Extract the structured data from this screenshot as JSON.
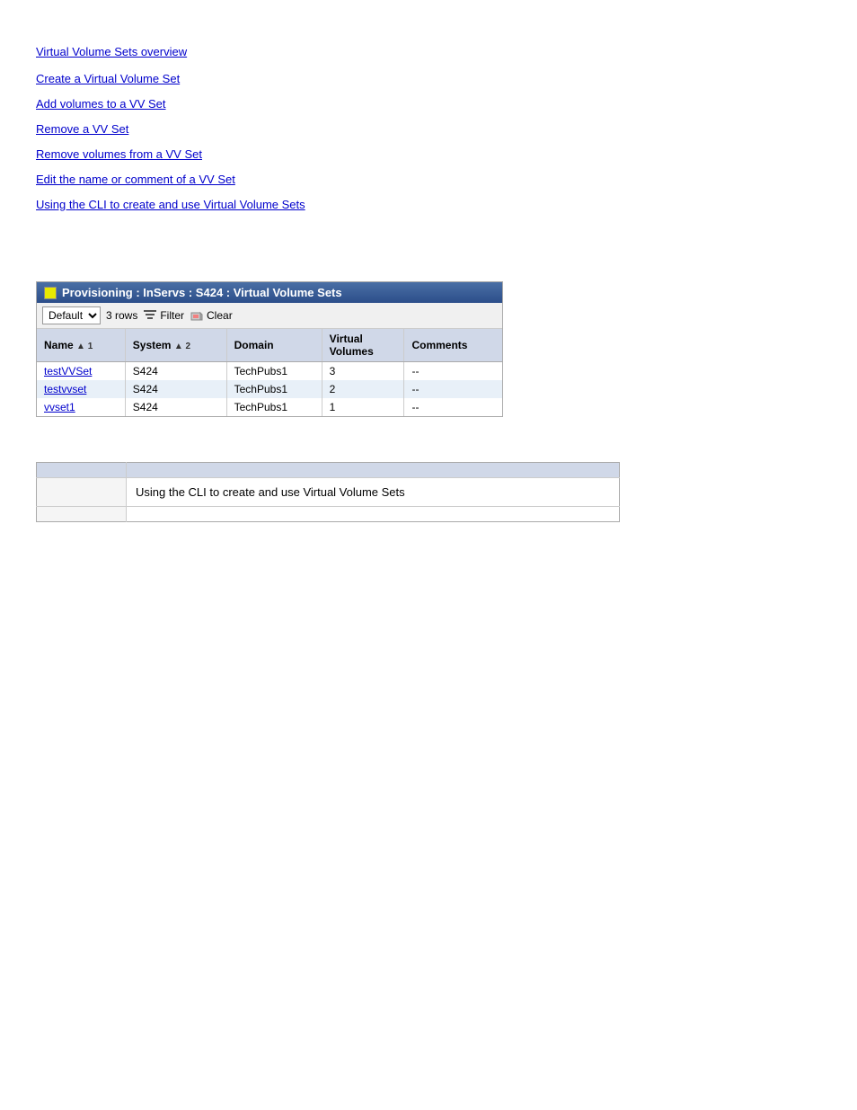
{
  "top_link": {
    "label": "Virtual Volume Sets overview"
  },
  "links_section": {
    "items": [
      {
        "label": "Create a Virtual Volume Set"
      },
      {
        "label": "Add volumes to a VV Set"
      },
      {
        "label": "Remove a VV Set"
      },
      {
        "label": "Remove volumes from a VV Set"
      },
      {
        "label": "Edit the name or comment of a VV Set"
      },
      {
        "label": "Using the CLI to create and use Virtual Volume Sets"
      }
    ]
  },
  "panel": {
    "title": "Provisioning : InServs : S424 : Virtual Volume Sets",
    "toolbar": {
      "view_label": "Default",
      "rows_count": "3 rows",
      "filter_label": "Filter",
      "clear_label": "Clear"
    },
    "columns": [
      {
        "label": "Name",
        "sort": "▲ 1"
      },
      {
        "label": "System",
        "sort": "▲ 2"
      },
      {
        "label": "Domain",
        "sort": ""
      },
      {
        "label": "Virtual\nVolumes",
        "sort": ""
      },
      {
        "label": "Comments",
        "sort": ""
      }
    ],
    "rows": [
      {
        "name": "testVVSet",
        "system": "S424",
        "domain": "TechPubs1",
        "volumes": "3",
        "comments": "--"
      },
      {
        "name": "testvvset",
        "system": "S424",
        "domain": "TechPubs1",
        "volumes": "2",
        "comments": "--"
      },
      {
        "name": "vvset1",
        "system": "S424",
        "domain": "TechPubs1",
        "volumes": "1",
        "comments": "--"
      }
    ]
  },
  "info_table": {
    "rows": [
      {
        "label": "",
        "value": ""
      },
      {
        "label": "",
        "value": "Using the CLI to create and use Virtual Volume Sets"
      },
      {
        "label": "",
        "value": ""
      }
    ]
  }
}
